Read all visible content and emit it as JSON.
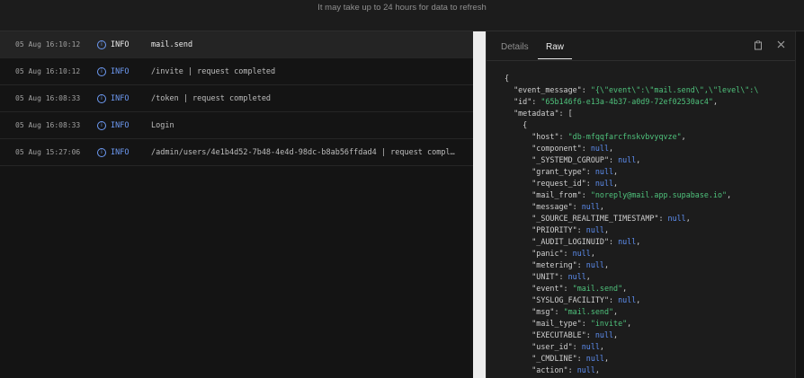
{
  "notice": "It may take up to 24 hours for data to refresh",
  "logs": [
    {
      "ts": "05 Aug 16:10:12",
      "level": "INFO",
      "msg": "mail.send",
      "selected": true
    },
    {
      "ts": "05 Aug 16:10:12",
      "level": "INFO",
      "msg": "/invite | request completed",
      "selected": false
    },
    {
      "ts": "05 Aug 16:08:33",
      "level": "INFO",
      "msg": "/token | request completed",
      "selected": false
    },
    {
      "ts": "05 Aug 16:08:33",
      "level": "INFO",
      "msg": "Login",
      "selected": false
    },
    {
      "ts": "05 Aug 15:27:06",
      "level": "INFO",
      "msg": "/admin/users/4e1b4d52-7b48-4e4d-98dc-b8ab56ffdad4 | request compl…",
      "selected": false
    }
  ],
  "detail": {
    "tabs": [
      "Details",
      "Raw"
    ],
    "active_tab": "Raw",
    "json_lines": [
      {
        "indent": 0,
        "parts": [
          [
            "k",
            "{"
          ]
        ]
      },
      {
        "indent": 1,
        "parts": [
          [
            "k",
            "\"event_message\": "
          ],
          [
            "s",
            "\"{\\\"event\\\":\\\"mail.send\\\",\\\"level\\\":\\"
          ]
        ]
      },
      {
        "indent": 1,
        "parts": [
          [
            "k",
            "\"id\": "
          ],
          [
            "s",
            "\"65b146f6-e13a-4b37-a0d9-72ef02530ac4\""
          ],
          [
            "k",
            ","
          ]
        ]
      },
      {
        "indent": 1,
        "parts": [
          [
            "k",
            "\"metadata\": ["
          ]
        ]
      },
      {
        "indent": 2,
        "parts": [
          [
            "k",
            "{"
          ]
        ]
      },
      {
        "indent": 3,
        "parts": [
          [
            "k",
            "\"host\": "
          ],
          [
            "s",
            "\"db-mfqqfarcfnskvbvyqvze\""
          ],
          [
            "k",
            ","
          ]
        ]
      },
      {
        "indent": 3,
        "parts": [
          [
            "k",
            "\"component\": "
          ],
          [
            "n",
            "null"
          ],
          [
            "k",
            ","
          ]
        ]
      },
      {
        "indent": 3,
        "parts": [
          [
            "k",
            "\"_SYSTEMD_CGROUP\": "
          ],
          [
            "n",
            "null"
          ],
          [
            "k",
            ","
          ]
        ]
      },
      {
        "indent": 3,
        "parts": [
          [
            "k",
            "\"grant_type\": "
          ],
          [
            "n",
            "null"
          ],
          [
            "k",
            ","
          ]
        ]
      },
      {
        "indent": 3,
        "parts": [
          [
            "k",
            "\"request_id\": "
          ],
          [
            "n",
            "null"
          ],
          [
            "k",
            ","
          ]
        ]
      },
      {
        "indent": 3,
        "parts": [
          [
            "k",
            "\"mail_from\": "
          ],
          [
            "s",
            "\"noreply@mail.app.supabase.io\""
          ],
          [
            "k",
            ","
          ]
        ]
      },
      {
        "indent": 3,
        "parts": [
          [
            "k",
            "\"message\": "
          ],
          [
            "n",
            "null"
          ],
          [
            "k",
            ","
          ]
        ]
      },
      {
        "indent": 3,
        "parts": [
          [
            "k",
            "\"_SOURCE_REALTIME_TIMESTAMP\": "
          ],
          [
            "n",
            "null"
          ],
          [
            "k",
            ","
          ]
        ]
      },
      {
        "indent": 3,
        "parts": [
          [
            "k",
            "\"PRIORITY\": "
          ],
          [
            "n",
            "null"
          ],
          [
            "k",
            ","
          ]
        ]
      },
      {
        "indent": 3,
        "parts": [
          [
            "k",
            "\"_AUDIT_LOGINUID\": "
          ],
          [
            "n",
            "null"
          ],
          [
            "k",
            ","
          ]
        ]
      },
      {
        "indent": 3,
        "parts": [
          [
            "k",
            "\"panic\": "
          ],
          [
            "n",
            "null"
          ],
          [
            "k",
            ","
          ]
        ]
      },
      {
        "indent": 3,
        "parts": [
          [
            "k",
            "\"metering\": "
          ],
          [
            "n",
            "null"
          ],
          [
            "k",
            ","
          ]
        ]
      },
      {
        "indent": 3,
        "parts": [
          [
            "k",
            "\"UNIT\": "
          ],
          [
            "n",
            "null"
          ],
          [
            "k",
            ","
          ]
        ]
      },
      {
        "indent": 3,
        "parts": [
          [
            "k",
            "\"event\": "
          ],
          [
            "s",
            "\"mail.send\""
          ],
          [
            "k",
            ","
          ]
        ]
      },
      {
        "indent": 3,
        "parts": [
          [
            "k",
            "\"SYSLOG_FACILITY\": "
          ],
          [
            "n",
            "null"
          ],
          [
            "k",
            ","
          ]
        ]
      },
      {
        "indent": 3,
        "parts": [
          [
            "k",
            "\"msg\": "
          ],
          [
            "s",
            "\"mail.send\""
          ],
          [
            "k",
            ","
          ]
        ]
      },
      {
        "indent": 3,
        "parts": [
          [
            "k",
            "\"mail_type\": "
          ],
          [
            "s",
            "\"invite\""
          ],
          [
            "k",
            ","
          ]
        ]
      },
      {
        "indent": 3,
        "parts": [
          [
            "k",
            "\"EXECUTABLE\": "
          ],
          [
            "n",
            "null"
          ],
          [
            "k",
            ","
          ]
        ]
      },
      {
        "indent": 3,
        "parts": [
          [
            "k",
            "\"user_id\": "
          ],
          [
            "n",
            "null"
          ],
          [
            "k",
            ","
          ]
        ]
      },
      {
        "indent": 3,
        "parts": [
          [
            "k",
            "\"_CMDLINE\": "
          ],
          [
            "n",
            "null"
          ],
          [
            "k",
            ","
          ]
        ]
      },
      {
        "indent": 3,
        "parts": [
          [
            "k",
            "\"action\": "
          ],
          [
            "n",
            "null"
          ],
          [
            "k",
            ","
          ]
        ]
      }
    ]
  },
  "icons": {
    "copy": "copy-icon",
    "close": "close-icon",
    "info": "info-icon"
  }
}
